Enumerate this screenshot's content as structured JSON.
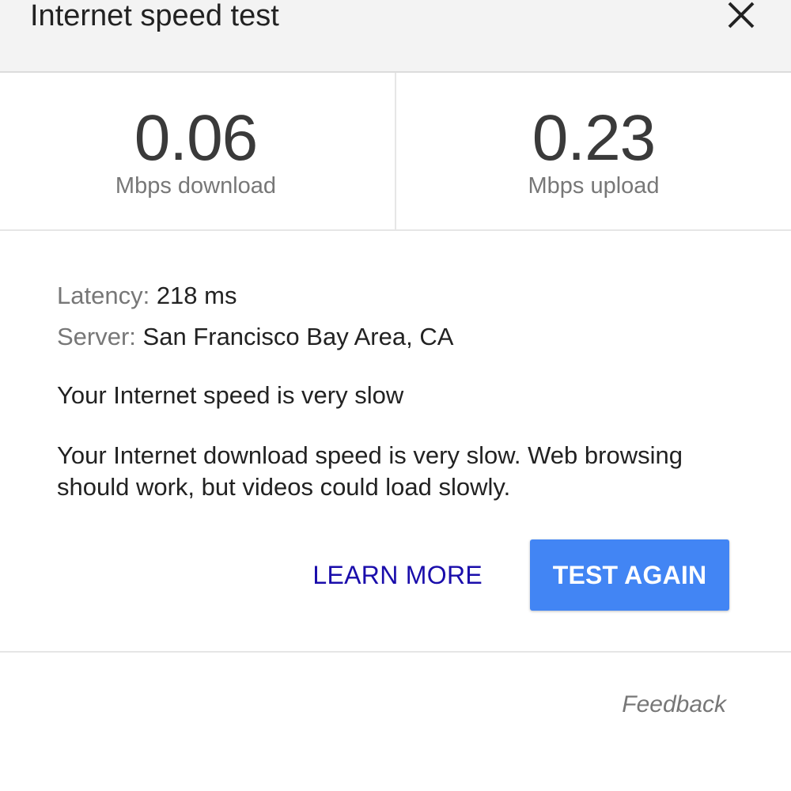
{
  "header": {
    "title": "Internet speed test",
    "close_icon": "close-icon"
  },
  "speeds": {
    "download": {
      "value": "0.06",
      "label": "Mbps download"
    },
    "upload": {
      "value": "0.23",
      "label": "Mbps upload"
    }
  },
  "details": {
    "latency_key": "Latency:",
    "latency_value": " 218 ms",
    "server_key": "Server:",
    "server_value": " San Francisco Bay Area, CA",
    "verdict": "Your Internet speed is very slow",
    "explanation": "Your Internet download speed is very slow. Web browsing should work, but videos could load slowly."
  },
  "actions": {
    "learn_more": "LEARN MORE",
    "test_again": "TEST AGAIN"
  },
  "footer": {
    "feedback": "Feedback"
  },
  "colors": {
    "primary_button": "#4285f4",
    "link": "#1a0dab",
    "header_bg": "#f3f3f3"
  }
}
